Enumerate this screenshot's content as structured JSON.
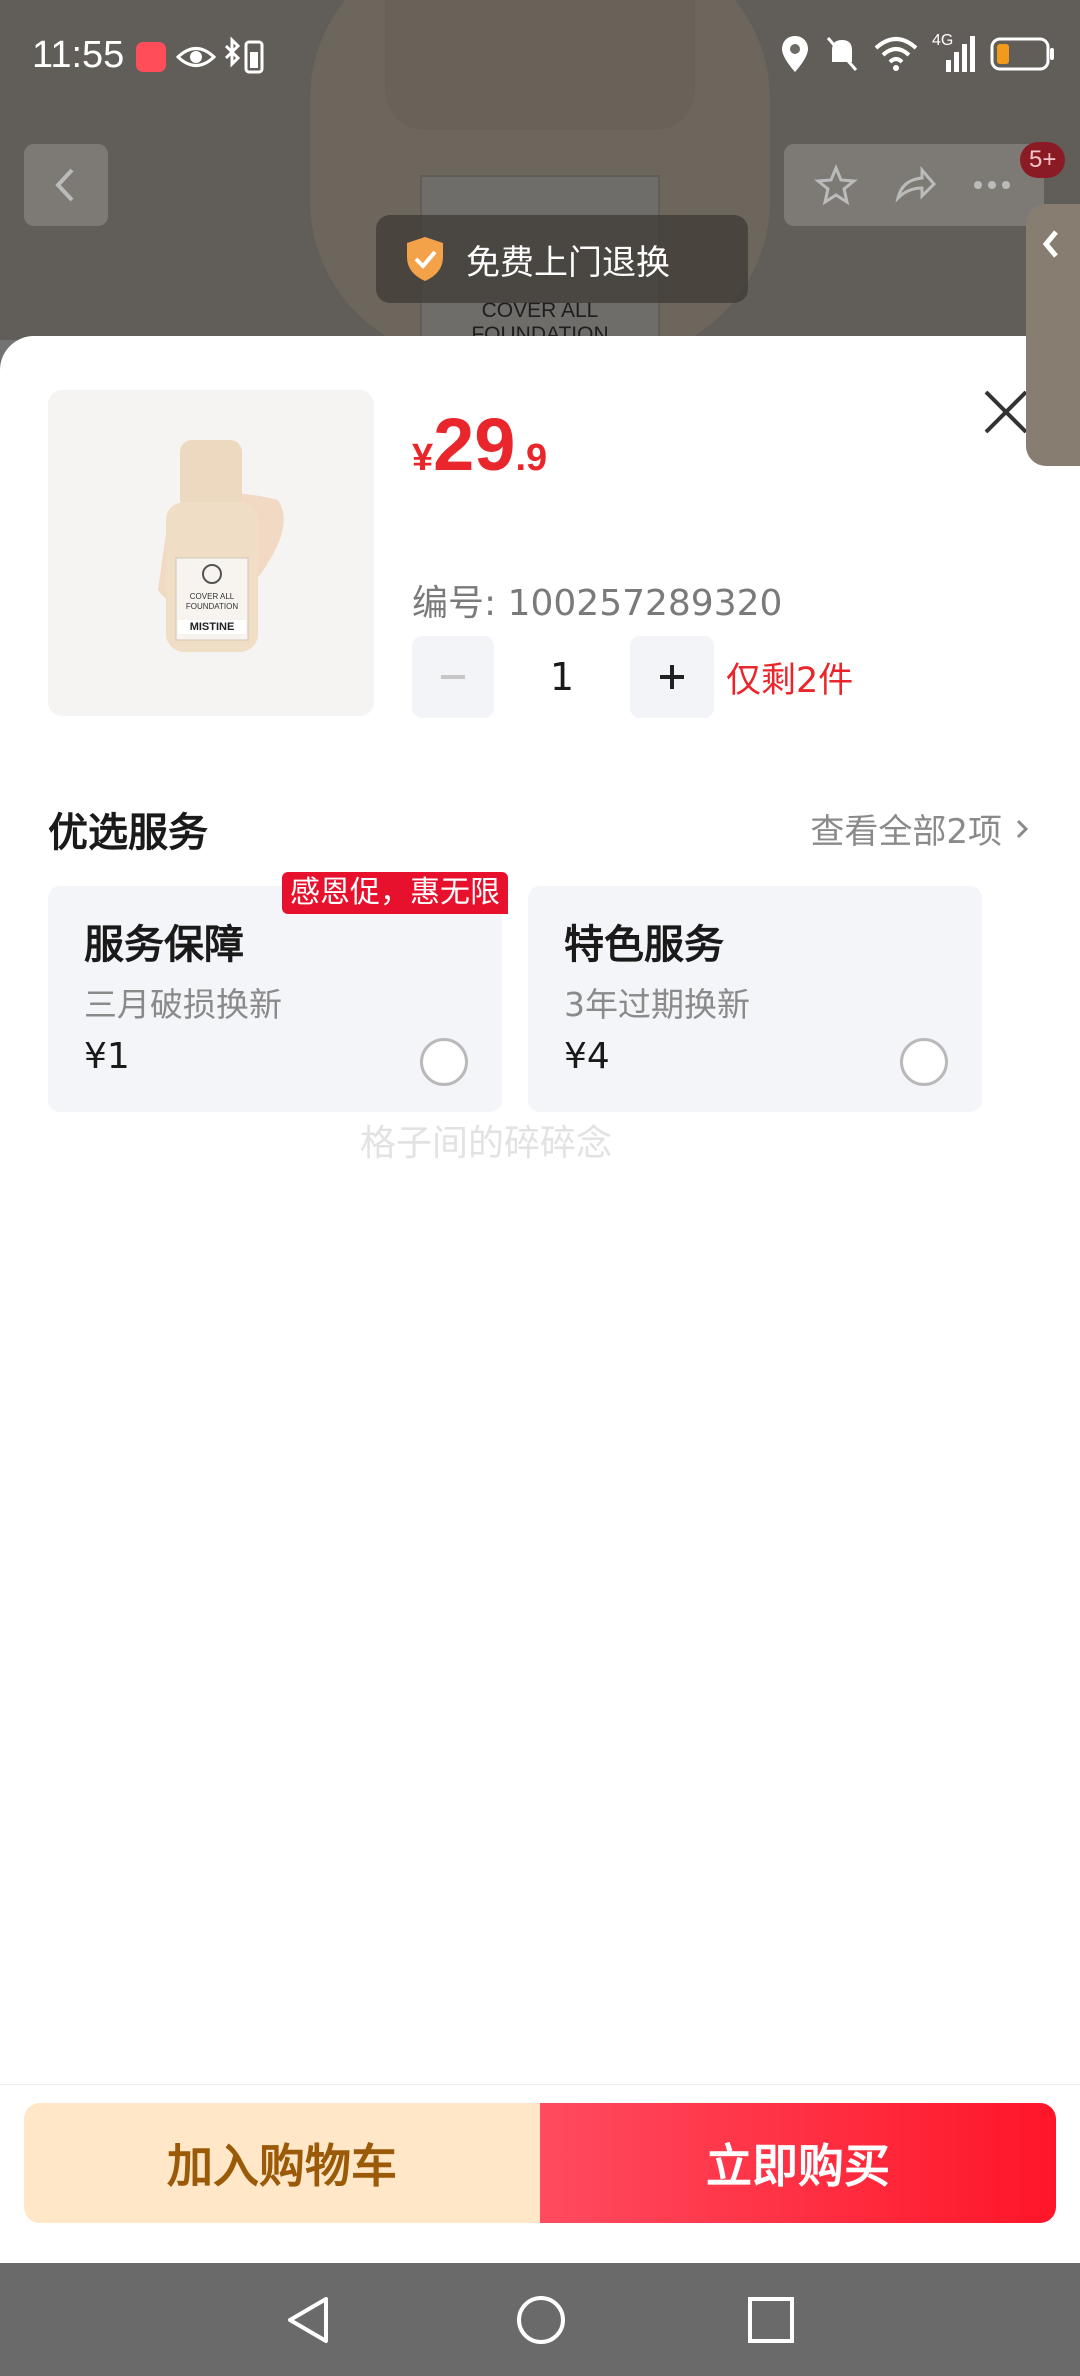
{
  "status_bar": {
    "time": "11:55",
    "network": "4G"
  },
  "background_page": {
    "label_line1": "COVER ALL",
    "label_line2": "FOUNDATION",
    "cart_badge": "5+",
    "free_return": "免费上门退换"
  },
  "product": {
    "thumb_label_line1": "COVER ALL",
    "thumb_label_line2": "FOUNDATION",
    "thumb_brand": "MISTINE",
    "price_symbol": "¥",
    "price_int": "29",
    "price_dec": ".9",
    "sku": "编号: 100257289320",
    "quantity": "1",
    "stock_note": "仅剩2件"
  },
  "services": {
    "title": "优选服务",
    "view_all": "查看全部2项",
    "promo_tag": "感恩促，惠无限",
    "items": [
      {
        "name": "服务保障",
        "desc": "三月破损换新",
        "price": "¥1",
        "selected": false
      },
      {
        "name": "特色服务",
        "desc": "3年过期换新",
        "price": "¥4",
        "selected": false
      }
    ]
  },
  "watermark": "格子间的碎碎念",
  "actions": {
    "add_to_cart": "加入购物车",
    "buy_now": "立即购买"
  },
  "colors": {
    "price_red": "#e8262b",
    "cart_bg": "#ffe7c8",
    "cart_text": "#9a5a07",
    "buy_start": "#ff4b5f",
    "buy_end": "#ff1528"
  }
}
